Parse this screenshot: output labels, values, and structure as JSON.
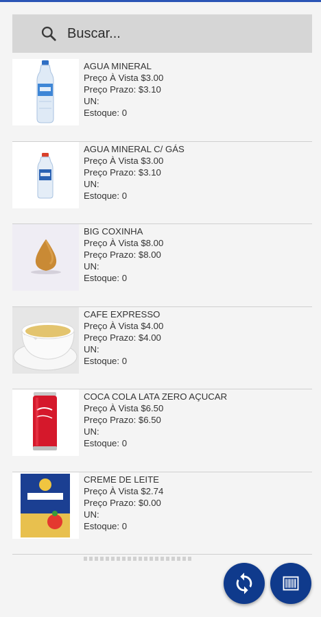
{
  "search": {
    "placeholder": "Buscar...",
    "icon": "search-icon"
  },
  "colors": {
    "accent": "#0f3a8c",
    "top_line": "#2b55b5",
    "search_bg": "#d6d6d6"
  },
  "products": [
    {
      "name": "AGUA MINERAL",
      "price_cash": "Preço À Vista $3.00",
      "price_term": "Preço Prazo: $3.10",
      "unit": "UN:",
      "stock": "Estoque: 0",
      "image": "water-bottle-image"
    },
    {
      "name": "AGUA MINERAL C/ GÁS",
      "price_cash": "Preço À Vista $3.00",
      "price_term": "Preço Prazo: $3.10",
      "unit": "UN:",
      "stock": "Estoque: 0",
      "image": "sparkling-water-bottle-image"
    },
    {
      "name": "BIG COXINHA",
      "price_cash": "Preço À Vista $8.00",
      "price_term": "Preço Prazo: $8.00",
      "unit": "UN:",
      "stock": "Estoque: 0",
      "image": "coxinha-image"
    },
    {
      "name": "CAFE EXPRESSO",
      "price_cash": "Preço À Vista $4.00",
      "price_term": "Preço Prazo: $4.00",
      "unit": "UN:",
      "stock": "Estoque: 0",
      "image": "coffee-cup-image"
    },
    {
      "name": "COCA COLA LATA ZERO AÇUCAR",
      "price_cash": "Preço À Vista $6.50",
      "price_term": "Preço Prazo: $6.50",
      "unit": "UN:",
      "stock": "Estoque: 0",
      "image": "coke-can-image"
    },
    {
      "name": "CREME DE LEITE",
      "price_cash": "Preço À Vista $2.74",
      "price_term": "Preço Prazo: $0.00",
      "unit": "UN:",
      "stock": "Estoque: 0",
      "image": "cream-box-image"
    }
  ],
  "fabs": {
    "sync": "sync-icon",
    "barcode": "barcode-icon"
  }
}
